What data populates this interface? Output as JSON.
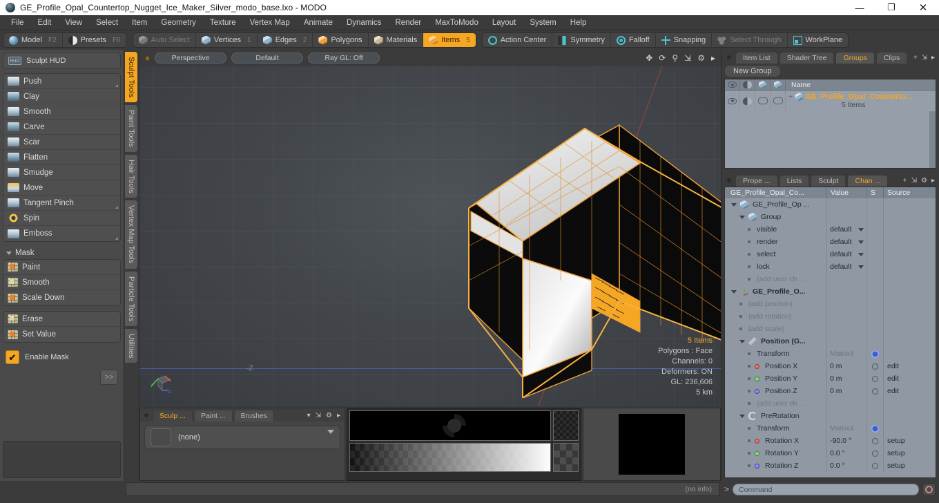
{
  "window": {
    "title": "GE_Profile_Opal_Countertop_Nugget_Ice_Maker_Silver_modo_base.lxo - MODO",
    "minimize": "—",
    "maximize": "❐",
    "close": "✕"
  },
  "menubar": [
    "File",
    "Edit",
    "View",
    "Select",
    "Item",
    "Geometry",
    "Texture",
    "Vertex Map",
    "Animate",
    "Dynamics",
    "Render",
    "MaxToModo",
    "Layout",
    "System",
    "Help"
  ],
  "modebar": {
    "left": [
      {
        "label": "Model",
        "key": "F2",
        "icon": "sphere-icon",
        "state": "normal"
      },
      {
        "label": "Presets",
        "key": "F6",
        "icon": "preset-sphere-icon",
        "state": "normal"
      }
    ],
    "selection": [
      {
        "label": "Auto Select",
        "key": "",
        "icon": "cube-icon-gray",
        "state": "disabled"
      },
      {
        "label": "Vertices",
        "key": "1",
        "icon": "cube-icon-blue",
        "state": "normal"
      },
      {
        "label": "Edges",
        "key": "2",
        "icon": "cube-icon-blue",
        "state": "normal"
      },
      {
        "label": "Polygons",
        "key": "",
        "icon": "cube-icon-orange",
        "state": "normal"
      },
      {
        "label": "Materials",
        "key": "",
        "icon": "cube-icon-tan",
        "state": "normal"
      },
      {
        "label": "Items",
        "key": "5",
        "icon": "cube-icon-orange",
        "state": "active"
      }
    ],
    "options": [
      {
        "label": "Action Center",
        "icon": "crosshair-ring-icon",
        "state": "normal"
      },
      {
        "label": "Symmetry",
        "icon": "symmetry-icon",
        "state": "normal"
      },
      {
        "label": "Falloff",
        "icon": "falloff-icon",
        "state": "normal"
      },
      {
        "label": "Snapping",
        "icon": "snapping-icon",
        "state": "normal"
      },
      {
        "label": "Select Through",
        "icon": "select-through-icon",
        "state": "disabled"
      },
      {
        "label": "WorkPlane",
        "icon": "workplane-icon",
        "state": "normal"
      }
    ]
  },
  "left_panel": {
    "hud_label": "Sculpt HUD",
    "hud_icon_text": "HUD",
    "sculpt_tools": [
      {
        "label": "Push",
        "icon": "push-brush-icon",
        "has_corner": true
      },
      {
        "label": "Clay",
        "icon": "clay-brush-icon",
        "has_corner": false
      },
      {
        "label": "Smooth",
        "icon": "smooth-brush-icon",
        "has_corner": false
      },
      {
        "label": "Carve",
        "icon": "carve-brush-icon",
        "has_corner": false
      },
      {
        "label": "Scar",
        "icon": "scar-brush-icon",
        "has_corner": false
      },
      {
        "label": "Flatten",
        "icon": "flatten-brush-icon",
        "has_corner": false
      },
      {
        "label": "Smudge",
        "icon": "smudge-brush-icon",
        "has_corner": false
      },
      {
        "label": "Move",
        "icon": "move-brush-icon",
        "has_corner": false
      },
      {
        "label": "Tangent Pinch",
        "icon": "tangent-pinch-brush-icon",
        "has_corner": true
      },
      {
        "label": "Spin",
        "icon": "spin-brush-icon",
        "has_corner": false
      },
      {
        "label": "Emboss",
        "icon": "emboss-brush-icon",
        "has_corner": true
      }
    ],
    "mask_section_label": "Mask",
    "mask_tools": [
      {
        "label": "Paint",
        "icon": "mask-paint-icon"
      },
      {
        "label": "Smooth",
        "icon": "mask-smooth-icon"
      },
      {
        "label": "Scale Down",
        "icon": "mask-scale-down-icon"
      }
    ],
    "mask_tools2": [
      {
        "label": "Erase",
        "icon": "mask-erase-icon"
      },
      {
        "label": "Set Value",
        "icon": "mask-set-value-icon"
      }
    ],
    "enable_mask_label": "Enable Mask",
    "enable_mask_checked": true,
    "more_label": ">>"
  },
  "vertical_tabs": [
    {
      "label": "Sculpt Tools",
      "active": true
    },
    {
      "label": "Paint Tools",
      "active": false
    },
    {
      "label": "Hair Tools",
      "active": false
    },
    {
      "label": "Vertex Map Tools",
      "active": false
    },
    {
      "label": "Particle Tools",
      "active": false
    },
    {
      "label": "Utilities",
      "active": false
    }
  ],
  "viewport": {
    "header_buttons": [
      "Perspective",
      "Default",
      "Ray GL: Off"
    ],
    "tool_icons": [
      "move-icon",
      "rotate-icon",
      "zoom-icon",
      "fit-icon",
      "gear-icon",
      "chevron-right-icon"
    ],
    "axis_label": "-Z",
    "gizmo_axes": [
      "x",
      "y",
      "z"
    ],
    "stats": {
      "items": "5 Items",
      "polygons": "Polygons : Face",
      "channels": "Channels: 0",
      "deformers": "Deformers: ON",
      "gl": "GL: 236,606",
      "scale": "5 km"
    }
  },
  "bottom_panel": {
    "tabs": [
      {
        "label": "Sculp ...",
        "active": true
      },
      {
        "label": "Paint ...",
        "active": false
      },
      {
        "label": "Brushes",
        "active": false
      }
    ],
    "tool_icons": [
      "chevron-down-icon",
      "expand-icon",
      "gear-icon",
      "chevron-right-icon"
    ],
    "brush_slot_value": "(none)"
  },
  "right_panel": {
    "top_tabs": [
      {
        "label": "Item List",
        "active": false
      },
      {
        "label": "Shader Tree",
        "active": false
      },
      {
        "label": "Groups",
        "active": true
      },
      {
        "label": "Clips",
        "active": false
      }
    ],
    "top_tab_tools": [
      "plus-icon",
      "expand-icon",
      "chevron-right-icon"
    ],
    "new_group_label": "New Group",
    "list_columns": [
      "eye-icon",
      "render-icon",
      "select-icon",
      "lock-icon",
      "Name"
    ],
    "list_name_header": "Name",
    "group_row": {
      "name": "GE_Profile_Opal_Counterto...",
      "subtitle": "5 Items",
      "icon": "cube-icon"
    },
    "bottom_tabs": [
      {
        "label": "Prope ...",
        "active": false
      },
      {
        "label": "Lists",
        "active": false
      },
      {
        "label": "Sculpt",
        "active": false
      },
      {
        "label": "Chan ...",
        "active": true
      }
    ],
    "bottom_tab_tools": [
      "plus-icon",
      "expand-icon",
      "gear-icon",
      "chevron-right-icon"
    ],
    "channel_columns": {
      "name": "GE_Profile_Opal_Co...",
      "value": "Value",
      "s": "S",
      "source": "Source"
    },
    "channels": [
      {
        "indent": 0,
        "twist": true,
        "icon": "cube-icon",
        "label": "GE_Profile_Op ...",
        "value": "",
        "s": "",
        "source": "",
        "bold": false,
        "dim": false
      },
      {
        "indent": 1,
        "twist": true,
        "icon": "cube-icon",
        "label": "Group",
        "value": "",
        "s": "",
        "source": "",
        "bold": false,
        "dim": false
      },
      {
        "indent": 2,
        "twist": false,
        "icon": "leaf",
        "label": "visible",
        "value": "default",
        "dropdown": true,
        "s": "",
        "source": "",
        "bold": false,
        "dim": false
      },
      {
        "indent": 2,
        "twist": false,
        "icon": "leaf",
        "label": "render",
        "value": "default",
        "dropdown": true,
        "s": "",
        "source": "",
        "bold": false,
        "dim": false
      },
      {
        "indent": 2,
        "twist": false,
        "icon": "leaf",
        "label": "select",
        "value": "default",
        "dropdown": true,
        "s": "",
        "source": "",
        "bold": false,
        "dim": false
      },
      {
        "indent": 2,
        "twist": false,
        "icon": "leaf",
        "label": "lock",
        "value": "default",
        "dropdown": true,
        "s": "",
        "source": "",
        "bold": false,
        "dim": false
      },
      {
        "indent": 2,
        "twist": false,
        "icon": "leaf",
        "label": "(add user ch ...",
        "value": "",
        "s": "",
        "source": "",
        "bold": false,
        "dim": true
      },
      {
        "indent": 0,
        "twist": true,
        "icon": "locator-icon",
        "label": "GE_Profile_O...",
        "value": "",
        "s": "",
        "source": "",
        "bold": true,
        "dim": false
      },
      {
        "indent": 1,
        "twist": false,
        "icon": "leaf",
        "label": "(add position)",
        "value": "",
        "s": "",
        "source": "",
        "bold": false,
        "dim": true
      },
      {
        "indent": 1,
        "twist": false,
        "icon": "leaf",
        "label": "(add rotation)",
        "value": "",
        "s": "",
        "source": "",
        "bold": false,
        "dim": true
      },
      {
        "indent": 1,
        "twist": false,
        "icon": "leaf",
        "label": "(add scale)",
        "value": "",
        "s": "",
        "source": "",
        "bold": false,
        "dim": true
      },
      {
        "indent": 1,
        "twist": true,
        "icon": "position-icon",
        "label": "Position (G...",
        "value": "",
        "s": "",
        "source": "",
        "bold": true,
        "dim": false
      },
      {
        "indent": 2,
        "twist": false,
        "icon": "leaf",
        "label": "Transform",
        "value": "Matrix4",
        "valuedim": true,
        "s": "gear",
        "source": "",
        "bold": false,
        "dim": false
      },
      {
        "indent": 2,
        "twist": false,
        "icon": "axis-x",
        "label": "Position X",
        "value": "0 m",
        "s": "circle",
        "source": "edit",
        "bold": false,
        "dim": false
      },
      {
        "indent": 2,
        "twist": false,
        "icon": "axis-y",
        "label": "Position Y",
        "value": "0 m",
        "s": "circle",
        "source": "edit",
        "bold": false,
        "dim": false
      },
      {
        "indent": 2,
        "twist": false,
        "icon": "axis-z",
        "label": "Position Z",
        "value": "0 m",
        "s": "circle",
        "source": "edit",
        "bold": false,
        "dim": false
      },
      {
        "indent": 2,
        "twist": false,
        "icon": "leaf",
        "label": "(add user ch ...",
        "value": "",
        "s": "",
        "source": "",
        "bold": false,
        "dim": true
      },
      {
        "indent": 1,
        "twist": true,
        "icon": "rotation-icon",
        "label": "PreRotation",
        "value": "",
        "s": "",
        "source": "",
        "bold": false,
        "dim": false
      },
      {
        "indent": 2,
        "twist": false,
        "icon": "leaf",
        "label": "Transform",
        "value": "Matrix4",
        "valuedim": true,
        "s": "gear",
        "source": "",
        "bold": false,
        "dim": false
      },
      {
        "indent": 2,
        "twist": false,
        "icon": "axis-x",
        "label": "Rotation X",
        "value": "-90.0 °",
        "s": "circle",
        "source": "setup",
        "bold": false,
        "dim": false
      },
      {
        "indent": 2,
        "twist": false,
        "icon": "axis-y",
        "label": "Rotation Y",
        "value": "0.0 °",
        "s": "circle",
        "source": "setup",
        "bold": false,
        "dim": false
      },
      {
        "indent": 2,
        "twist": false,
        "icon": "axis-z",
        "label": "Rotation Z",
        "value": "0.0 °",
        "s": "circle",
        "source": "setup",
        "bold": false,
        "dim": false
      }
    ]
  },
  "statusbar": {
    "info": "(no info)",
    "command_prompt": ">",
    "command_placeholder": "Command",
    "record_icon": "record-icon"
  },
  "colors": {
    "accent": "#f5a623",
    "teal": "#49c6d0",
    "panel": "#3b3b3b",
    "list_bg": "#8f98a3"
  }
}
